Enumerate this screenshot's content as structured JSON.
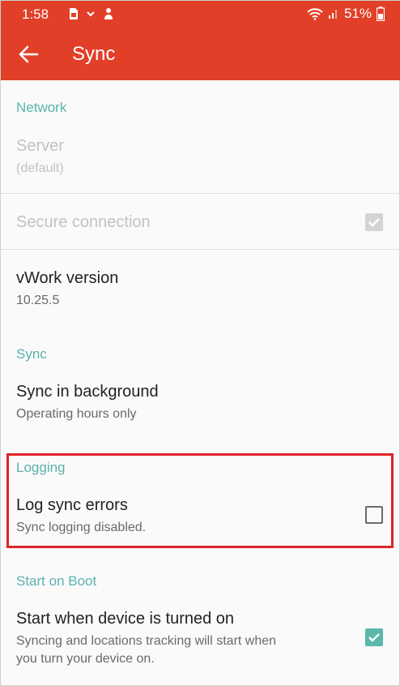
{
  "status_bar": {
    "time": "1:58",
    "battery": "51%",
    "icons": [
      "sim-card-icon",
      "chevron-down-icon",
      "notification-icon",
      "wifi-icon",
      "signal-icon",
      "battery-icon"
    ]
  },
  "app_bar": {
    "title": "Sync",
    "back_icon": "arrow-left-icon"
  },
  "sections": {
    "network": {
      "header": "Network",
      "server_title": "Server",
      "server_summary": "(default)",
      "secure_title": "Secure connection",
      "secure_checked": true,
      "version_title": "vWork version",
      "version_value": "10.25.5"
    },
    "sync": {
      "header": "Sync",
      "background_title": "Sync in background",
      "background_summary": "Operating hours only"
    },
    "logging": {
      "header": "Logging",
      "log_title": "Log sync errors",
      "log_summary": "Sync logging disabled.",
      "log_checked": false
    },
    "boot": {
      "header": "Start on Boot",
      "start_title": "Start when device is turned on",
      "start_summary_line1": "Syncing and locations tracking will start when",
      "start_summary_line2": "you turn your device on.",
      "start_checked": true
    }
  },
  "colors": {
    "accent": "#e23f28",
    "section_header": "#59b3ae",
    "checkbox_checked": "#5cb7ab",
    "highlight": "#e0232a"
  }
}
